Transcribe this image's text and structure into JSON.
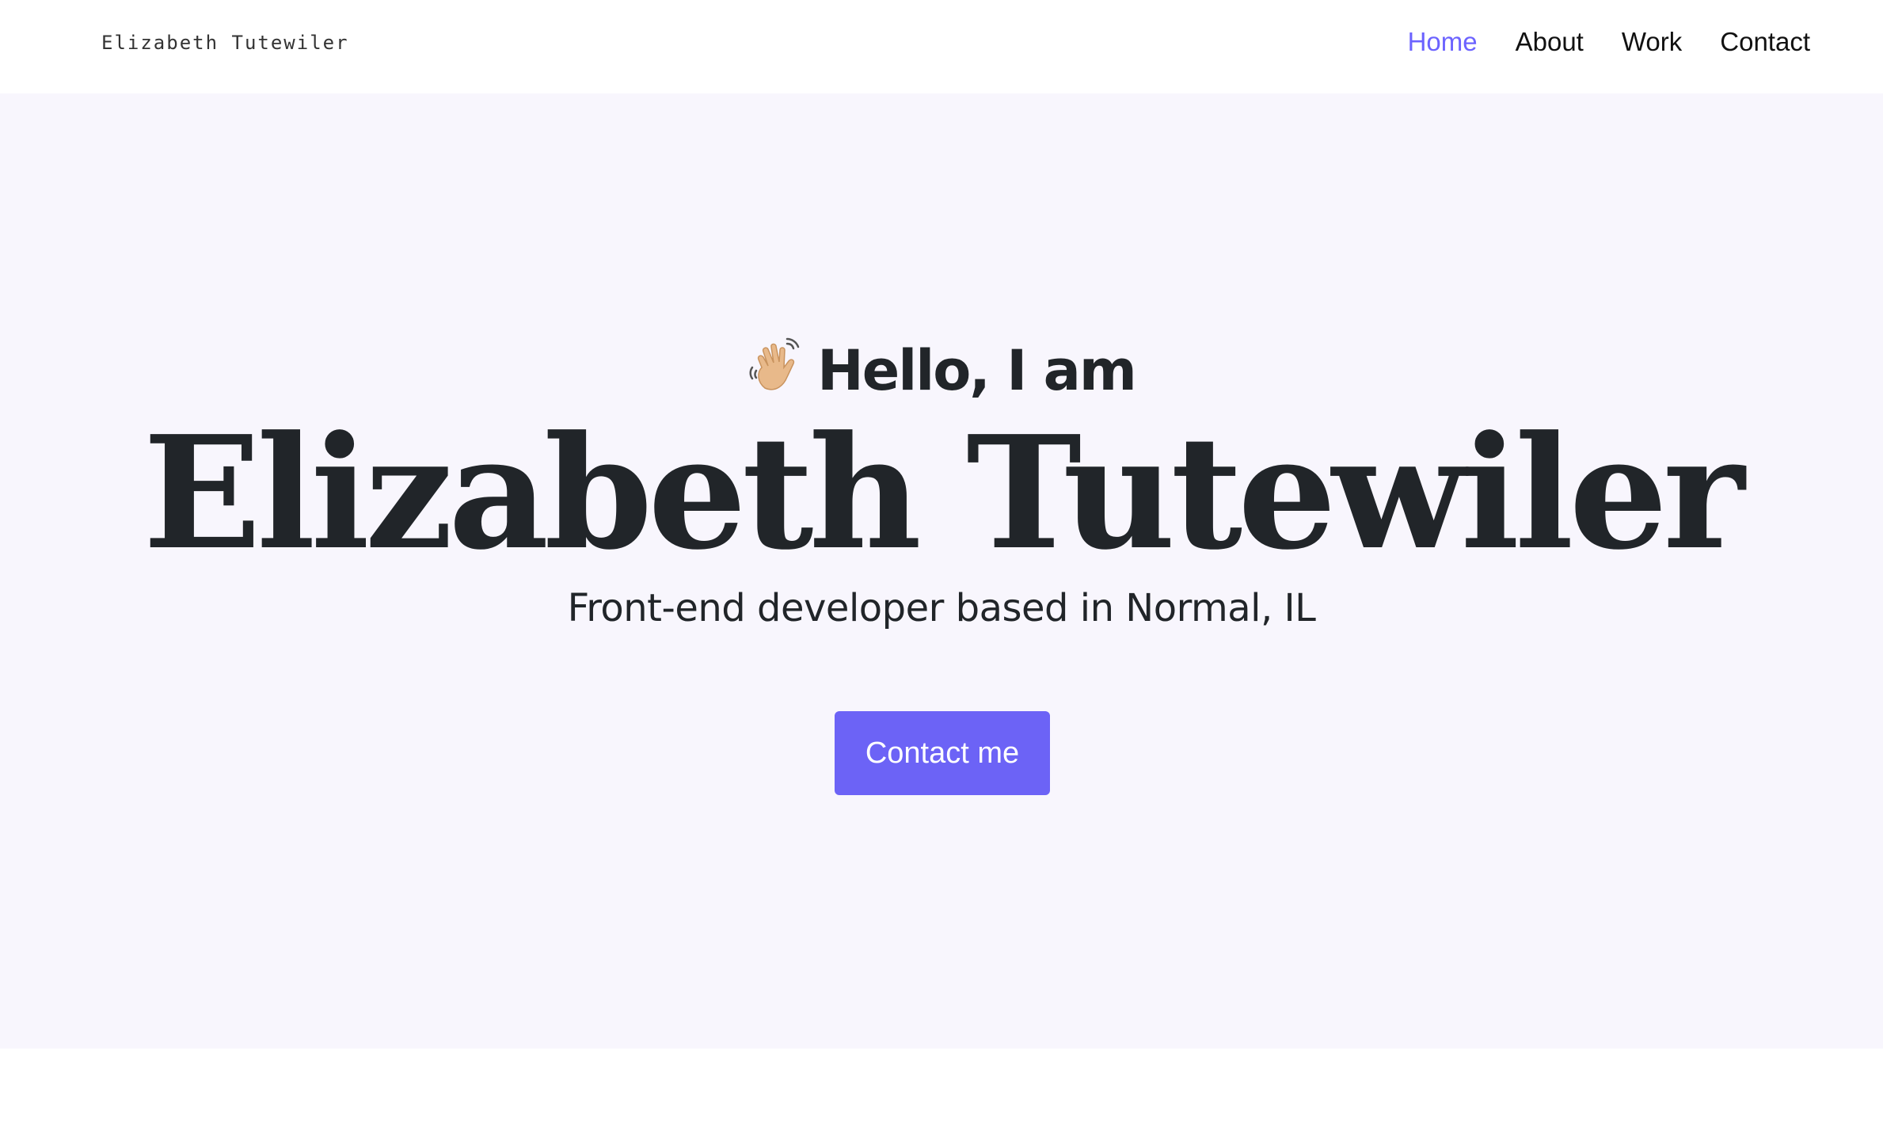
{
  "header": {
    "brand": "Elizabeth Tutewiler",
    "nav": [
      {
        "label": "Home",
        "active": true
      },
      {
        "label": "About",
        "active": false
      },
      {
        "label": "Work",
        "active": false
      },
      {
        "label": "Contact",
        "active": false
      }
    ]
  },
  "hero": {
    "greeting_emoji": "waving-hand-icon",
    "greeting": "Hello, I am",
    "name": "Elizabeth Tutewiler",
    "tagline": "Front-end developer based in Normal, IL",
    "cta_label": "Contact me"
  },
  "colors": {
    "accent": "#6c63ff",
    "hero_background": "#f8f6fd",
    "text": "#212529"
  }
}
